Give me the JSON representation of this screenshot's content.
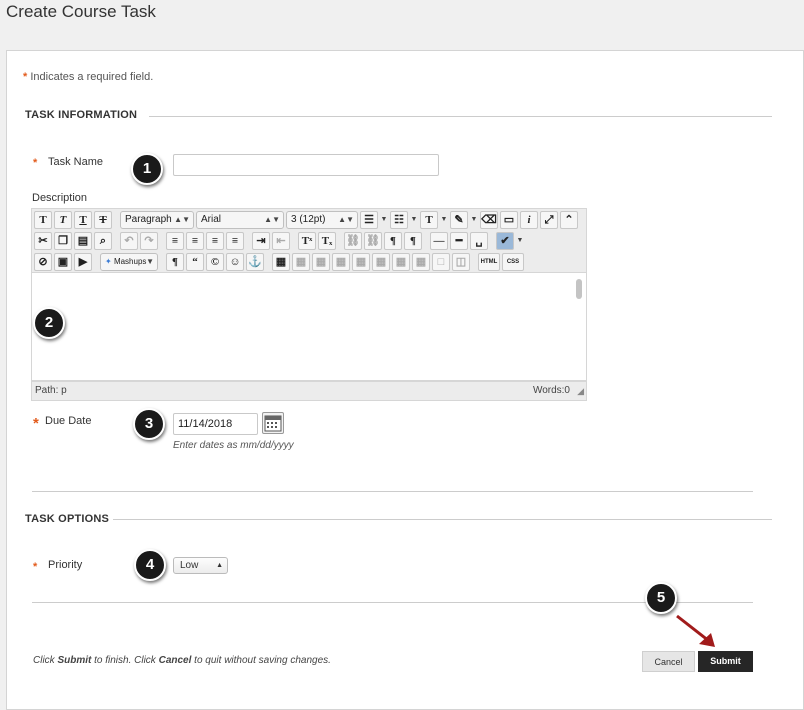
{
  "page": {
    "title": "Create Course Task"
  },
  "required_note": {
    "star": "*",
    "text": "Indicates a required field."
  },
  "task_information": {
    "header": "TASK INFORMATION",
    "task_name": {
      "label": "Task Name",
      "value": "",
      "placeholder": ""
    },
    "description": {
      "label": "Description"
    }
  },
  "toolbar": {
    "row1": {
      "format_select": "Paragraph",
      "font_select": "Arial",
      "size_select": "3 (12pt)"
    },
    "row3": {
      "mashups_label": "Mashups",
      "html_label": "HTML",
      "css_label": "CSS"
    }
  },
  "editor": {
    "path_label": "Path: p",
    "words_label": "Words:0"
  },
  "due_date": {
    "label": "Due Date",
    "value": "11/14/2018",
    "hint": "Enter dates as mm/dd/yyyy"
  },
  "task_options": {
    "header": "TASK OPTIONS",
    "priority": {
      "label": "Priority",
      "selected": "Low"
    }
  },
  "footer": {
    "note_prefix": "Click ",
    "note_submit": "Submit",
    "note_mid": " to finish. Click ",
    "note_cancel": "Cancel",
    "note_suffix": " to quit without saving changes.",
    "cancel_label": "Cancel",
    "submit_label": "Submit"
  },
  "callouts": [
    "1",
    "2",
    "3",
    "4",
    "5"
  ],
  "colors": {
    "required_star": "#e25b1c",
    "submit_bg": "#262626",
    "arrow": "#a11b1b"
  }
}
